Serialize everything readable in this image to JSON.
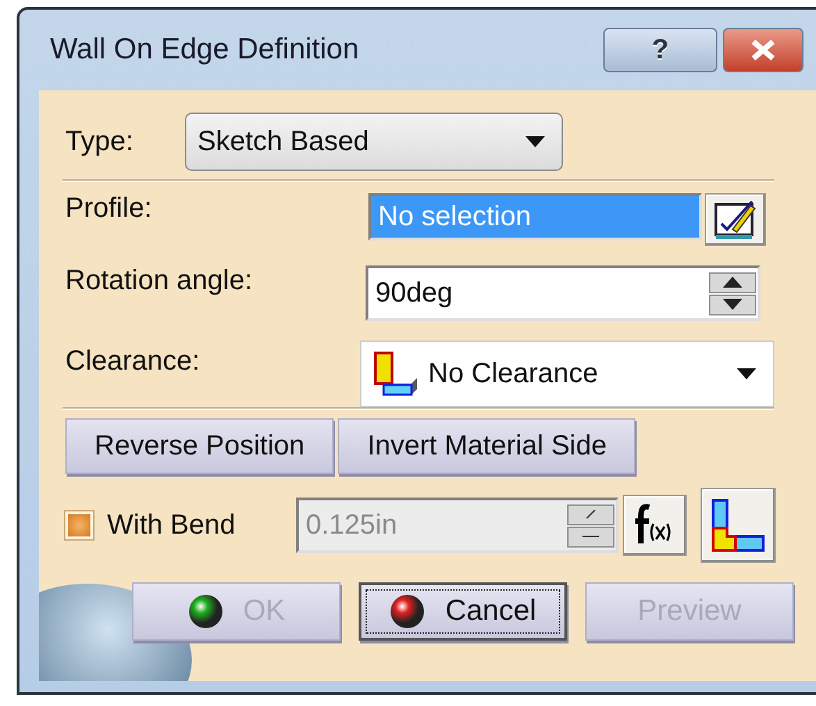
{
  "window": {
    "title": "Wall On Edge Definition",
    "help_button": "?"
  },
  "type": {
    "label": "Type:",
    "value": "Sketch Based"
  },
  "profile": {
    "label": "Profile:",
    "value": "No selection",
    "selected": true
  },
  "rotation_angle": {
    "label": "Rotation angle:",
    "value": "90deg"
  },
  "clearance": {
    "label": "Clearance:",
    "value": "No Clearance"
  },
  "action_buttons": [
    {
      "label": "Reverse Position"
    },
    {
      "label": "Invert Material Side"
    }
  ],
  "with_bend": {
    "label": "With Bend",
    "checked": true,
    "radius": "0.125in",
    "disabled": true
  },
  "footer_buttons": [
    {
      "label": "OK",
      "kind": "ok",
      "disabled": true,
      "focused": false
    },
    {
      "label": "Cancel",
      "kind": "cancel",
      "disabled": false,
      "focused": true
    },
    {
      "label": "Preview",
      "kind": "plain",
      "disabled": true,
      "focused": false
    }
  ]
}
